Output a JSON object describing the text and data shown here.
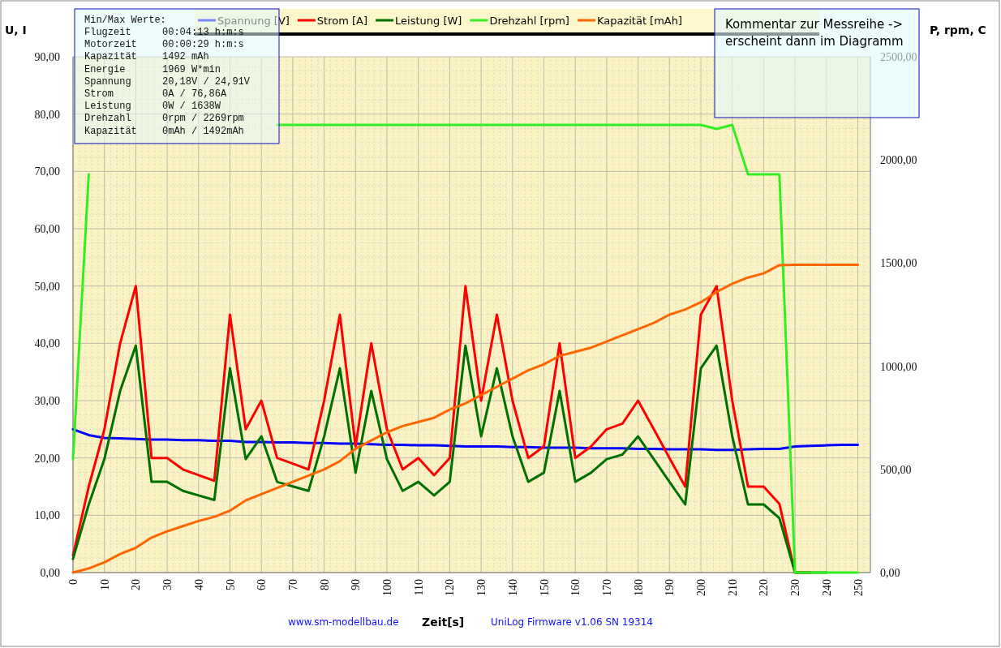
{
  "chart": {
    "left_axis_title": "U, I",
    "right_axis_title": "P, rpm, C",
    "chart_data": {
      "type": "line",
      "xlabel": "Zeit[s]",
      "x": [
        0,
        5,
        10,
        15,
        20,
        25,
        30,
        35,
        40,
        45,
        50,
        55,
        60,
        65,
        70,
        75,
        80,
        85,
        90,
        95,
        100,
        105,
        110,
        115,
        120,
        125,
        130,
        135,
        140,
        145,
        150,
        155,
        160,
        165,
        170,
        175,
        180,
        185,
        190,
        195,
        200,
        205,
        210,
        215,
        220,
        225,
        230,
        235,
        240,
        245,
        250
      ],
      "series": [
        {
          "name": "Spannung [V]",
          "color": "#0000ff",
          "values": [
            25,
            24,
            23.5,
            23.4,
            23.3,
            23.2,
            23.2,
            23.1,
            23.1,
            23,
            23,
            22.8,
            22.8,
            22.7,
            22.7,
            22.6,
            22.6,
            22.5,
            22.5,
            22.4,
            22.3,
            22.3,
            22.2,
            22.2,
            22.1,
            22,
            22,
            22,
            21.9,
            21.9,
            21.8,
            21.8,
            21.8,
            21.7,
            21.7,
            21.7,
            21.6,
            21.6,
            21.5,
            21.5,
            21.5,
            21.4,
            21.4,
            21.5,
            21.6,
            21.6,
            22,
            22.1,
            22.2,
            22.3,
            22.3
          ]
        },
        {
          "name": "Strom [A]",
          "color": "#ff0000",
          "values": [
            3,
            15,
            25,
            40,
            50,
            20,
            20,
            18,
            17,
            16,
            45,
            25,
            30,
            20,
            19,
            18,
            30,
            45,
            22,
            40,
            25,
            18,
            20,
            17,
            20,
            50,
            30,
            45,
            30,
            20,
            22,
            40,
            20,
            22,
            25,
            26,
            30,
            25,
            20,
            15,
            45,
            50,
            30,
            15,
            15,
            12,
            0,
            0,
            null,
            null,
            null
          ]
        },
        {
          "name": "Leistung [W]",
          "color": "#007000",
          "axis": "y2",
          "values": [
            66,
            330,
            550,
            880,
            1100,
            440,
            440,
            396,
            374,
            352,
            990,
            550,
            660,
            440,
            418,
            396,
            660,
            990,
            484,
            880,
            550,
            396,
            440,
            374,
            440,
            1100,
            660,
            990,
            660,
            440,
            484,
            880,
            440,
            484,
            550,
            572,
            660,
            550,
            440,
            330,
            990,
            1100,
            660,
            330,
            330,
            264,
            0,
            0,
            0,
            null,
            null
          ]
        },
        {
          "name": "Drehzahl [rpm]",
          "color": "#33ee22",
          "axis": "y2",
          "values": [
            550,
            1930,
            null,
            null,
            null,
            null,
            null,
            null,
            null,
            null,
            null,
            null,
            null,
            2170,
            2170,
            2170,
            2170,
            2170,
            2170,
            2170,
            2170,
            2170,
            2170,
            2170,
            2170,
            2170,
            2170,
            2170,
            2170,
            2170,
            2170,
            2170,
            2170,
            2170,
            2170,
            2170,
            2170,
            2170,
            2170,
            2170,
            2170,
            2150,
            2170,
            1930,
            1930,
            1930,
            0,
            0,
            0,
            0,
            0
          ]
        },
        {
          "name": "Kapazität [mAh]",
          "color": "#ff6600",
          "axis": "y2",
          "values": [
            0,
            20,
            50,
            90,
            120,
            170,
            200,
            225,
            250,
            270,
            300,
            350,
            380,
            410,
            440,
            470,
            500,
            540,
            600,
            640,
            680,
            710,
            730,
            750,
            790,
            820,
            860,
            900,
            940,
            980,
            1010,
            1050,
            1070,
            1090,
            1120,
            1150,
            1180,
            1210,
            1250,
            1275,
            1310,
            1360,
            1400,
            1430,
            1450,
            1490,
            1492,
            1492,
            1492,
            1492,
            1492
          ]
        }
      ],
      "xlim": [
        0,
        254
      ],
      "ylim": [
        0,
        90
      ],
      "y2lim": [
        0,
        2500
      ],
      "grid": true,
      "y2ticks": [
        {
          "value": 0,
          "label": "0,00"
        },
        {
          "value": 500,
          "label": "500,00"
        },
        {
          "value": 1000,
          "label": "1000,00"
        },
        {
          "value": 1500,
          "label": "1500,00"
        },
        {
          "value": 2000,
          "label": "2000,00"
        },
        {
          "value": 2500,
          "label": "2500,00"
        }
      ],
      "xticks": [
        0,
        10,
        20,
        30,
        40,
        50,
        60,
        70,
        80,
        90,
        100,
        110,
        120,
        130,
        140,
        150,
        160,
        170,
        180,
        190,
        200,
        210,
        220,
        230,
        240,
        250
      ],
      "yticks": [
        {
          "value": 0,
          "label": "0,00"
        },
        {
          "value": 10,
          "label": "10,00"
        },
        {
          "value": 20,
          "label": "20,00"
        },
        {
          "value": 30,
          "label": "30,00"
        },
        {
          "value": 40,
          "label": "40,00"
        },
        {
          "value": 50,
          "label": "50,00"
        },
        {
          "value": 60,
          "label": "60,00"
        },
        {
          "value": 70,
          "label": "70,00"
        },
        {
          "value": 80,
          "label": "80,00"
        },
        {
          "value": 90,
          "label": "90,00"
        }
      ]
    }
  },
  "info_box": {
    "title": "Min/Max Werte:",
    "rows": [
      {
        "label": "Flugzeit",
        "value": "00:04:13 h:m:s"
      },
      {
        "label": "Motorzeit",
        "value": "00:00:29 h:m:s"
      },
      {
        "label": "Kapazität",
        "value": "1492 mAh"
      },
      {
        "label": "Energie",
        "value": "1969 W*min"
      },
      {
        "label": "Spannung",
        "value": "20,18V / 24,91V"
      },
      {
        "label": "Strom",
        "value": "0A / 76,86A"
      },
      {
        "label": "Leistung",
        "value": "0W / 1638W"
      },
      {
        "label": "Drehzahl",
        "value": "0rpm / 2269rpm"
      },
      {
        "label": "Kapazität",
        "value": "0mAh / 1492mAh"
      }
    ]
  },
  "comment_box": {
    "lines": [
      "Kommentar zur Messreihe ->",
      "erscheint dann im Diagramm"
    ]
  },
  "footer": {
    "website": "www.sm-modellbau.de",
    "firmware": "UniLog Firmware  v1.06 SN 19314"
  }
}
